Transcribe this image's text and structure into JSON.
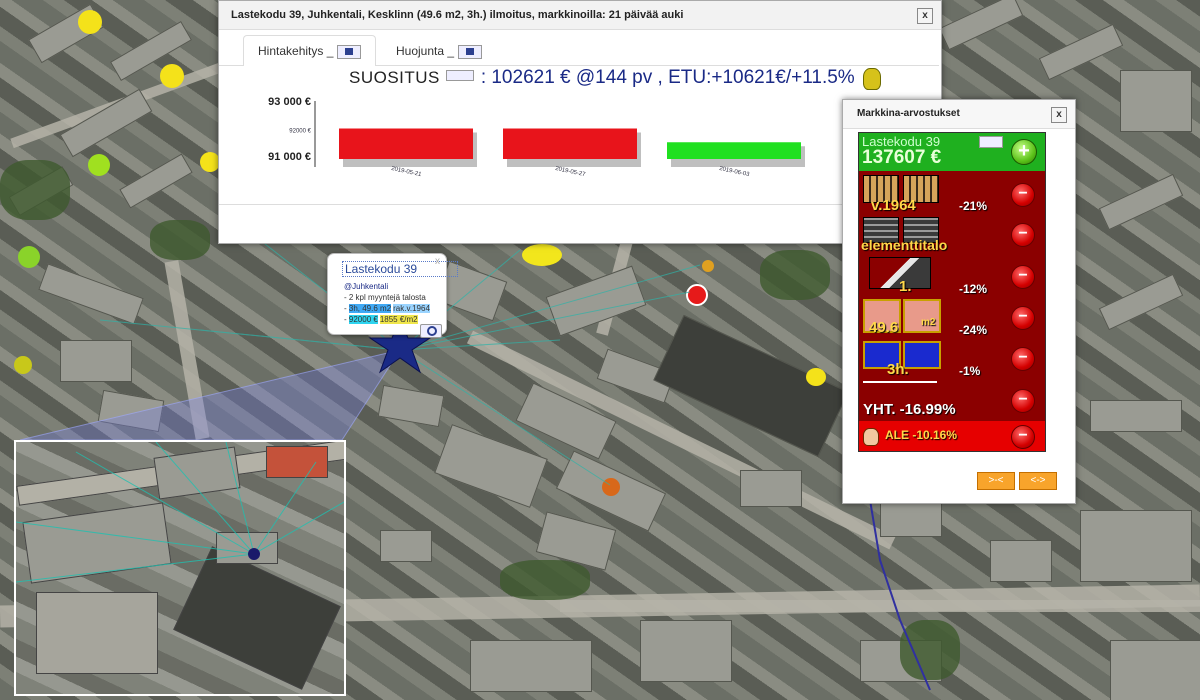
{
  "window1": {
    "title": "Lastekodu 39, Juhkentali, Kesklinn (49.6 m2, 3h.) ilmoitus, markkinoilla: 21 päivää auki",
    "close": "x",
    "tabs": [
      {
        "label": "Hintakehitys _"
      },
      {
        "label": "Huojunta _"
      }
    ],
    "suositus_label": "SUOSITUS",
    "suositus_value": ": 102621 € @144 pv , ETU:+10621€/+11.5%"
  },
  "chart_data": {
    "type": "bar",
    "categories": [
      "2019-05-21",
      "2019-05-27",
      "2019-06-03"
    ],
    "values": [
      92000,
      92000,
      91500
    ],
    "colors": [
      "#e8141b",
      "#e8141b",
      "#20e020"
    ],
    "ylim": [
      90600,
      93000
    ],
    "yticks": [
      {
        "label": "93 000 €",
        "value": 93000
      },
      {
        "label": "92000 €",
        "value": 92000
      },
      {
        "label": "91 000 €",
        "value": 91000
      }
    ],
    "grid": false
  },
  "popup": {
    "title": "Lastekodu 39",
    "area": "@Juhkentali",
    "line1": "- 2 kpl myyntejä talosta",
    "line2_dash": "- ",
    "line2_hl": "3h, 49.6 m2",
    "line2_tail": "rak.v.1964",
    "line3_dash": "- ",
    "line3_price": "92000 €",
    "line3_sqm": "1855 €/m2",
    "close": "x"
  },
  "markkina": {
    "title": "Markkina-arvostukset",
    "close": "x",
    "address": "Lastekodu 39",
    "price": "137607 €",
    "plus": "+",
    "minus": "−",
    "rows": [
      {
        "label": "v.1964",
        "pct": "-21%"
      },
      {
        "label": "elementtitalo",
        "pct": ""
      },
      {
        "label": "1.",
        "pct": "-12%"
      },
      {
        "label": "49.6",
        "label2": "m2",
        "pct": "-24%"
      },
      {
        "label": "3h.",
        "pct": "-1%"
      }
    ],
    "total": "YHT. -16.99%",
    "ale": "ALE -10.16%",
    "btn_left": ">-<",
    "btn_right": "<->"
  },
  "colors": {
    "accent_green": "#1fb01f",
    "panel_red": "#8b0000",
    "ale_red": "#e60000",
    "orange": "#f8a42b",
    "navy_text": "#1a2a86"
  }
}
